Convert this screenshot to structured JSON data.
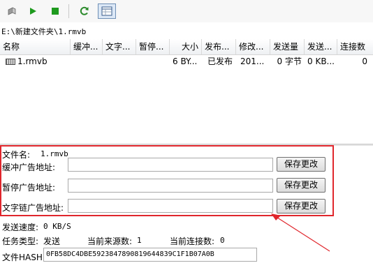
{
  "toolbar": {
    "buttons": [
      {
        "name": "open-folder-icon"
      },
      {
        "name": "play-icon"
      },
      {
        "name": "stop-icon"
      },
      {
        "name": "refresh-icon"
      },
      {
        "name": "grid-view-icon"
      }
    ],
    "colors": {
      "play": "#1e9a1e",
      "stop": "#1e9a1e",
      "refresh": "#2a8a2a"
    }
  },
  "path": "E:\\新建文件夹\\1.rmvb",
  "table": {
    "columns": [
      "名称",
      "缓冲...",
      "文字...",
      "暂停...",
      "大小",
      "发布...",
      "修改...",
      "发送量",
      "发送...",
      "连接数"
    ],
    "rows": [
      {
        "name": "1.rmvb",
        "buffer": "",
        "text": "",
        "pause": "",
        "size": "6 BY...",
        "publish": "已发布",
        "modified": "201...",
        "sent": "0 字节",
        "speed": "0 KB...",
        "connections": "0"
      }
    ]
  },
  "details": {
    "filename_label": "文件名:",
    "filename_value": "1.rmvb",
    "buffer_ad_label": "缓冲广告地址:",
    "buffer_ad_value": "",
    "pause_ad_label": "暂停广告地址:",
    "pause_ad_value": "",
    "textlink_ad_label": "文字链广告地址:",
    "textlink_ad_value": "",
    "save_label": "保存更改",
    "send_speed_label": "发送速度:",
    "send_speed_value": "0 KB/S",
    "task_type_label": "任务类型:",
    "task_type_value": "发送",
    "sources_label": "当前来源数:",
    "sources_value": "1",
    "connections_label": "当前连接数:",
    "connections_value": "0",
    "hash_label": "文件HASH:",
    "hash_value": "0FB58DC4DBE5923847890819644839C1F1B07A0B"
  },
  "annotation": {
    "color": "#e0262c"
  }
}
